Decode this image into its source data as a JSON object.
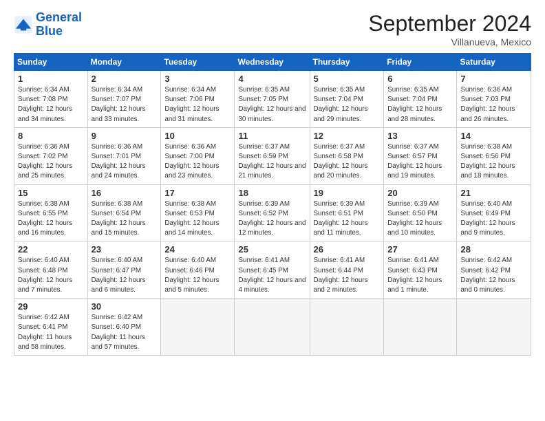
{
  "logo": {
    "line1": "General",
    "line2": "Blue"
  },
  "title": "September 2024",
  "subtitle": "Villanueva, Mexico",
  "days_header": [
    "Sunday",
    "Monday",
    "Tuesday",
    "Wednesday",
    "Thursday",
    "Friday",
    "Saturday"
  ],
  "weeks": [
    [
      {
        "num": "1",
        "sunrise": "6:34 AM",
        "sunset": "7:08 PM",
        "daylight": "12 hours and 34 minutes."
      },
      {
        "num": "2",
        "sunrise": "6:34 AM",
        "sunset": "7:07 PM",
        "daylight": "12 hours and 33 minutes."
      },
      {
        "num": "3",
        "sunrise": "6:34 AM",
        "sunset": "7:06 PM",
        "daylight": "12 hours and 31 minutes."
      },
      {
        "num": "4",
        "sunrise": "6:35 AM",
        "sunset": "7:05 PM",
        "daylight": "12 hours and 30 minutes."
      },
      {
        "num": "5",
        "sunrise": "6:35 AM",
        "sunset": "7:04 PM",
        "daylight": "12 hours and 29 minutes."
      },
      {
        "num": "6",
        "sunrise": "6:35 AM",
        "sunset": "7:04 PM",
        "daylight": "12 hours and 28 minutes."
      },
      {
        "num": "7",
        "sunrise": "6:36 AM",
        "sunset": "7:03 PM",
        "daylight": "12 hours and 26 minutes."
      }
    ],
    [
      {
        "num": "8",
        "sunrise": "6:36 AM",
        "sunset": "7:02 PM",
        "daylight": "12 hours and 25 minutes."
      },
      {
        "num": "9",
        "sunrise": "6:36 AM",
        "sunset": "7:01 PM",
        "daylight": "12 hours and 24 minutes."
      },
      {
        "num": "10",
        "sunrise": "6:36 AM",
        "sunset": "7:00 PM",
        "daylight": "12 hours and 23 minutes."
      },
      {
        "num": "11",
        "sunrise": "6:37 AM",
        "sunset": "6:59 PM",
        "daylight": "12 hours and 21 minutes."
      },
      {
        "num": "12",
        "sunrise": "6:37 AM",
        "sunset": "6:58 PM",
        "daylight": "12 hours and 20 minutes."
      },
      {
        "num": "13",
        "sunrise": "6:37 AM",
        "sunset": "6:57 PM",
        "daylight": "12 hours and 19 minutes."
      },
      {
        "num": "14",
        "sunrise": "6:38 AM",
        "sunset": "6:56 PM",
        "daylight": "12 hours and 18 minutes."
      }
    ],
    [
      {
        "num": "15",
        "sunrise": "6:38 AM",
        "sunset": "6:55 PM",
        "daylight": "12 hours and 16 minutes."
      },
      {
        "num": "16",
        "sunrise": "6:38 AM",
        "sunset": "6:54 PM",
        "daylight": "12 hours and 15 minutes."
      },
      {
        "num": "17",
        "sunrise": "6:38 AM",
        "sunset": "6:53 PM",
        "daylight": "12 hours and 14 minutes."
      },
      {
        "num": "18",
        "sunrise": "6:39 AM",
        "sunset": "6:52 PM",
        "daylight": "12 hours and 12 minutes."
      },
      {
        "num": "19",
        "sunrise": "6:39 AM",
        "sunset": "6:51 PM",
        "daylight": "12 hours and 11 minutes."
      },
      {
        "num": "20",
        "sunrise": "6:39 AM",
        "sunset": "6:50 PM",
        "daylight": "12 hours and 10 minutes."
      },
      {
        "num": "21",
        "sunrise": "6:40 AM",
        "sunset": "6:49 PM",
        "daylight": "12 hours and 9 minutes."
      }
    ],
    [
      {
        "num": "22",
        "sunrise": "6:40 AM",
        "sunset": "6:48 PM",
        "daylight": "12 hours and 7 minutes."
      },
      {
        "num": "23",
        "sunrise": "6:40 AM",
        "sunset": "6:47 PM",
        "daylight": "12 hours and 6 minutes."
      },
      {
        "num": "24",
        "sunrise": "6:40 AM",
        "sunset": "6:46 PM",
        "daylight": "12 hours and 5 minutes."
      },
      {
        "num": "25",
        "sunrise": "6:41 AM",
        "sunset": "6:45 PM",
        "daylight": "12 hours and 4 minutes."
      },
      {
        "num": "26",
        "sunrise": "6:41 AM",
        "sunset": "6:44 PM",
        "daylight": "12 hours and 2 minutes."
      },
      {
        "num": "27",
        "sunrise": "6:41 AM",
        "sunset": "6:43 PM",
        "daylight": "12 hours and 1 minute."
      },
      {
        "num": "28",
        "sunrise": "6:42 AM",
        "sunset": "6:42 PM",
        "daylight": "12 hours and 0 minutes."
      }
    ],
    [
      {
        "num": "29",
        "sunrise": "6:42 AM",
        "sunset": "6:41 PM",
        "daylight": "11 hours and 58 minutes."
      },
      {
        "num": "30",
        "sunrise": "6:42 AM",
        "sunset": "6:40 PM",
        "daylight": "11 hours and 57 minutes."
      },
      null,
      null,
      null,
      null,
      null
    ]
  ]
}
